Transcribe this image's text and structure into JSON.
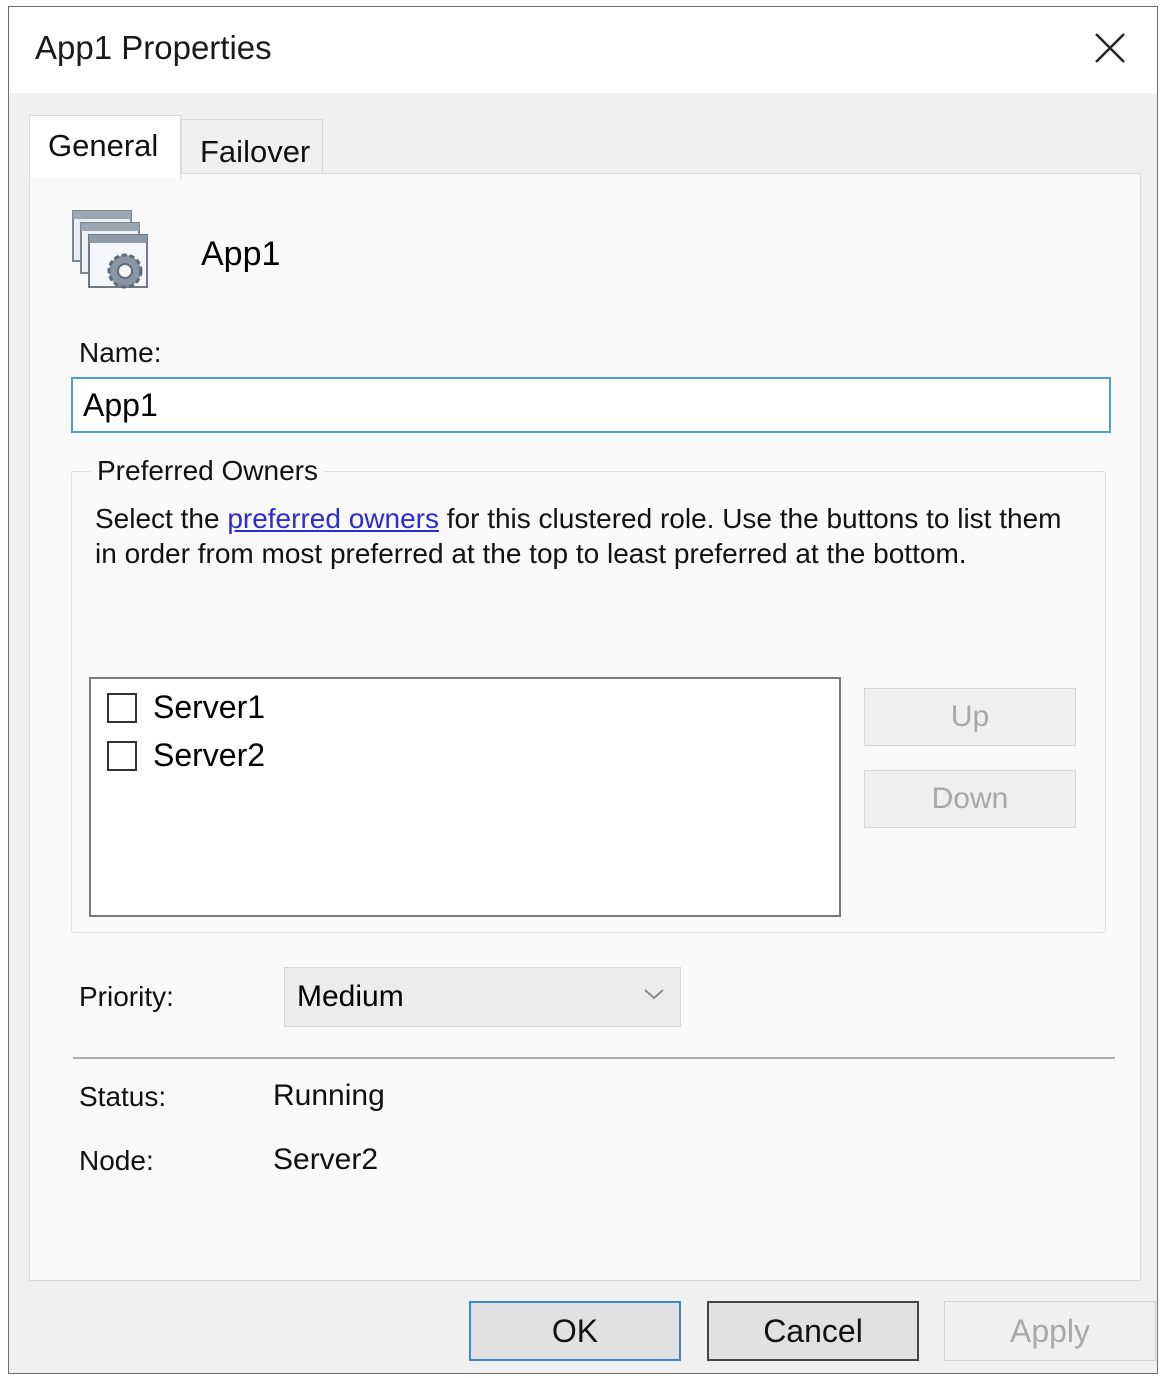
{
  "window": {
    "title": "App1 Properties",
    "close_icon": "close-icon"
  },
  "tabs": [
    {
      "label": "General",
      "selected": true
    },
    {
      "label": "Failover",
      "selected": false
    }
  ],
  "header": {
    "icon": "application-gear-icon",
    "name": "App1"
  },
  "name_field": {
    "label": "Name:",
    "value": "App1"
  },
  "preferred_owners": {
    "legend": "Preferred Owners",
    "desc_before": "Select the ",
    "desc_link": "preferred owners",
    "desc_after": " for this clustered role. Use the buttons to list them in order from most preferred at the top to least preferred at the bottom.",
    "items": [
      {
        "label": "Server1",
        "checked": false
      },
      {
        "label": "Server2",
        "checked": false
      }
    ],
    "up_label": "Up",
    "down_label": "Down"
  },
  "priority": {
    "label": "Priority:",
    "value": "Medium"
  },
  "status": {
    "label": "Status:",
    "value": "Running"
  },
  "node": {
    "label": "Node:",
    "value": "Server2"
  },
  "buttons": {
    "ok": "OK",
    "cancel": "Cancel",
    "apply": "Apply"
  },
  "colors": {
    "accent": "#4aa0d5",
    "link": "#2b2bd6",
    "disabled_text": "#a8a8a8"
  }
}
